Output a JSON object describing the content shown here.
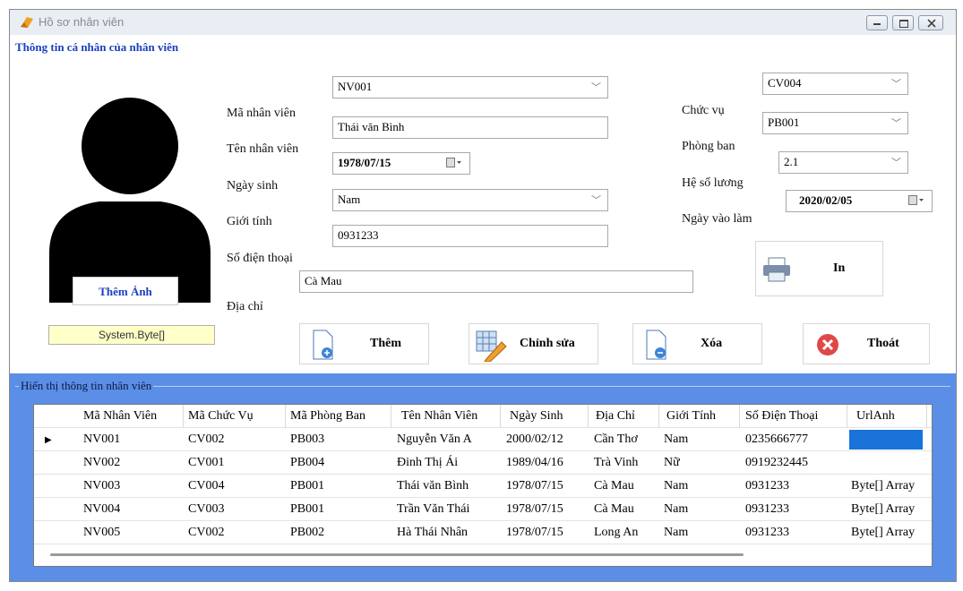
{
  "window": {
    "title": "Hồ sơ nhân viên"
  },
  "groups": {
    "personal_info": "Thông tin cá nhân của nhân viên",
    "display_info": "Hiển thị thông tin nhân viên"
  },
  "photo": {
    "add_photo_label": "Thêm Ảnh",
    "byte_field": "System.Byte[]"
  },
  "form": {
    "employee_id": {
      "label": "Mã nhân viên",
      "value": "NV001"
    },
    "employee_name": {
      "label": "Tên nhân viên",
      "value": "Thái văn Bình"
    },
    "birth_date": {
      "label": "Ngày sinh",
      "value": "1978/07/15"
    },
    "gender": {
      "label": "Giới tính",
      "value": "Nam"
    },
    "phone": {
      "label": "Số điện thoại",
      "value": "0931233"
    },
    "address": {
      "label": "Địa chỉ",
      "value": "Cà Mau"
    },
    "position": {
      "label": "Chức vụ",
      "value": "CV004"
    },
    "department": {
      "label": "Phòng ban",
      "value": "PB001"
    },
    "salary_coef": {
      "label": "Hệ số lương",
      "value": "2.1"
    },
    "start_date": {
      "label": "Ngày vào làm",
      "value": "2020/02/05"
    }
  },
  "buttons": {
    "print": "In",
    "add": "Thêm",
    "edit": "Chỉnh sửa",
    "delete": "Xóa",
    "exit": "Thoát"
  },
  "colors": {
    "group_caption": "#1a3fbf",
    "grid_panel": "#5b8ee6",
    "selection": "#1a73d9",
    "exit_icon": "#e04848"
  },
  "table": {
    "columns": [
      "Mã Nhân Viên",
      "Mã Chức Vụ",
      "Mã Phòng Ban",
      "Tên Nhân Viên",
      "Ngày Sinh",
      "Địa Chỉ",
      "Giới Tính",
      "Số Điện Thoại",
      "UrlAnh"
    ],
    "rows": [
      [
        "NV001",
        "CV002",
        "PB003",
        "Nguyễn Văn A",
        "2000/02/12",
        "Cần Thơ",
        "Nam",
        "0235666777",
        ""
      ],
      [
        "NV002",
        "CV001",
        "PB004",
        "Đinh Thị Ái",
        "1989/04/16",
        "Trà Vinh",
        "Nữ",
        "0919232445",
        ""
      ],
      [
        "NV003",
        "CV004",
        "PB001",
        "Thái văn Bình",
        "1978/07/15",
        "Cà Mau",
        "Nam",
        "0931233",
        "Byte[] Array"
      ],
      [
        "NV004",
        "CV003",
        "PB001",
        "Trần Văn Thái",
        "1978/07/15",
        "Cà Mau",
        "Nam",
        "0931233",
        "Byte[] Array"
      ],
      [
        "NV005",
        "CV002",
        "PB002",
        "Hà Thái Nhân",
        "1978/07/15",
        "Long An",
        "Nam",
        "0931233",
        "Byte[] Array"
      ]
    ],
    "current_row_marker": "▶"
  }
}
